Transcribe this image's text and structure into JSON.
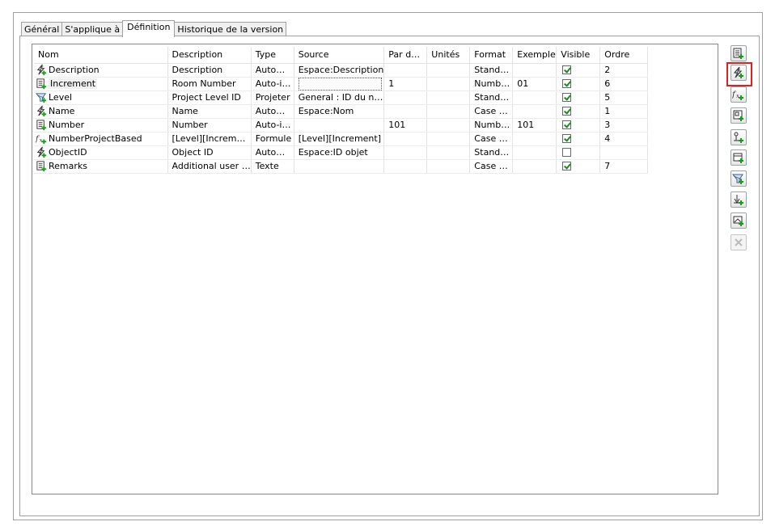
{
  "tabs": [
    {
      "label": "Général",
      "active": false
    },
    {
      "label": "S'applique à",
      "active": false
    },
    {
      "label": "Définition",
      "active": true
    },
    {
      "label": "Historique de la version",
      "active": false
    }
  ],
  "grid": {
    "columns": [
      "Nom",
      "Description",
      "Type",
      "Source",
      "Par d…",
      "Unités",
      "Format",
      "Exemple",
      "Visible",
      "Ordre"
    ],
    "rows": [
      {
        "icon": "automatic-property-icon",
        "name": "Description",
        "description": "Description",
        "type": "Auto…",
        "source": "Espace:Description",
        "default": "",
        "units": "",
        "format": "Stand…",
        "example": "",
        "visible": true,
        "order": "2"
      },
      {
        "icon": "manual-property-icon",
        "name": "Increment",
        "description": "Room Number",
        "type": "Auto-i…",
        "source": "",
        "default": "1",
        "units": "",
        "format": "Numb…",
        "example": "01",
        "visible": true,
        "order": "6"
      },
      {
        "icon": "level-property-icon",
        "name": "Level",
        "description": "Project Level ID",
        "type": "Projeter",
        "source": "General : ID du n…",
        "default": "",
        "units": "",
        "format": "Stand…",
        "example": "",
        "visible": true,
        "order": "5"
      },
      {
        "icon": "automatic-property-icon",
        "name": "Name",
        "description": "Name",
        "type": "Auto…",
        "source": "Espace:Nom",
        "default": "",
        "units": "",
        "format": "Case …",
        "example": "",
        "visible": true,
        "order": "1"
      },
      {
        "icon": "manual-property-icon",
        "name": "Number",
        "description": "Number",
        "type": "Auto-i…",
        "source": "",
        "default": "101",
        "units": "",
        "format": "Numb…",
        "example": "101",
        "visible": true,
        "order": "3"
      },
      {
        "icon": "formula-property-icon",
        "name": "NumberProjectBased",
        "description": "[Level][Increm…",
        "type": "Formule",
        "source": "[Level][Increment]",
        "default": "",
        "units": "",
        "format": "Case …",
        "example": "",
        "visible": true,
        "order": "4"
      },
      {
        "icon": "automatic-property-icon",
        "name": "ObjectID",
        "description": "Object ID",
        "type": "Auto…",
        "source": "Espace:ID objet",
        "default": "",
        "units": "",
        "format": "Stand…",
        "example": "",
        "visible": false,
        "order": ""
      },
      {
        "icon": "manual-property-icon",
        "name": "Remarks",
        "description": "Additional user …",
        "type": "Texte",
        "source": "",
        "default": "",
        "units": "",
        "format": "Case …",
        "example": "",
        "visible": true,
        "order": "7"
      }
    ]
  },
  "toolbar": [
    {
      "name": "add-manual-property-button",
      "icon": "manual-property-icon",
      "highlighted": false,
      "enabled": true
    },
    {
      "name": "add-automatic-property-button",
      "icon": "automatic-property-icon",
      "highlighted": true,
      "enabled": true
    },
    {
      "name": "add-formula-property-button",
      "icon": "formula-property-icon",
      "highlighted": false,
      "enabled": true
    },
    {
      "name": "add-anchor-property-button",
      "icon": "anchor-property-icon",
      "highlighted": false,
      "enabled": true
    },
    {
      "name": "add-location-property-button",
      "icon": "location-property-icon",
      "highlighted": false,
      "enabled": true
    },
    {
      "name": "add-classification-property-button",
      "icon": "classification-property-icon",
      "highlighted": false,
      "enabled": true
    },
    {
      "name": "add-level-property-button",
      "icon": "level-property-icon",
      "highlighted": false,
      "enabled": true
    },
    {
      "name": "add-material-property-button",
      "icon": "material-property-icon",
      "highlighted": false,
      "enabled": true
    },
    {
      "name": "add-graphic-property-button",
      "icon": "graphic-property-icon",
      "highlighted": false,
      "enabled": true
    },
    {
      "name": "delete-property-button",
      "icon": "delete-icon",
      "highlighted": false,
      "enabled": false
    }
  ],
  "colors": {
    "plus": "#1a9a1a",
    "highlight": "#e02020"
  }
}
